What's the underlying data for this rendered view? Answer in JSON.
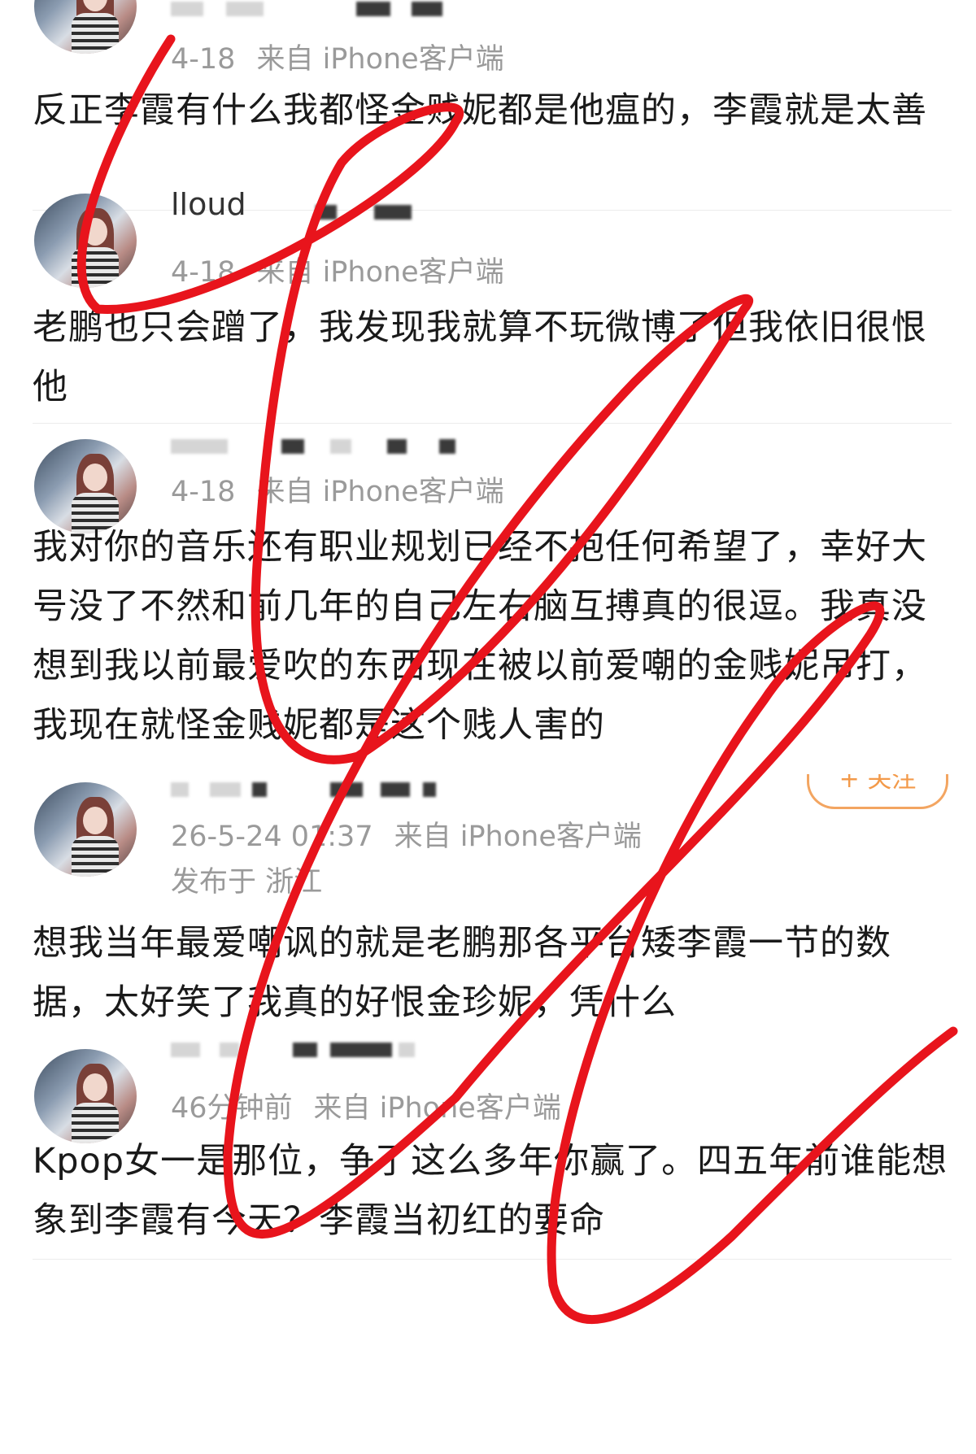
{
  "posts": [
    {
      "time": "4-18",
      "source": "来自 iPhone客户端",
      "content": "反正李霞有什么我都怪金贱妮都是他瘟的，李霞就是太善"
    },
    {
      "username": "lloud",
      "time": "4-18",
      "source": "来自 iPhone客户端",
      "content": "老鹏也只会蹭了，我发现我就算不玩微博了但我依旧很恨他"
    },
    {
      "time": "4-18",
      "source": "来自 iPhone客户端",
      "content": "我对你的音乐还有职业规划已经不抱任何希望了，幸好大号没了不然和前几年的自己左右脑互搏真的很逗。我真没想到我以前最爱吹的东西现在被以前爱嘲的金贱妮吊打，我现在就怪金贱妮都是这个贱人害的"
    },
    {
      "time": "26-5-24 01:37",
      "source": "来自 iPhone客户端",
      "location": "发布于 浙江",
      "follow_label": "+ 关注",
      "content": "想我当年最爱嘲讽的就是老鹏那各平台矮李霞一节的数据，太好笑了我真的好恨金珍妮，凭什么"
    },
    {
      "time": "46分钟前",
      "source": "来自 iPhone客户端",
      "content": "Kpop女一是那位，争了这么多年你赢了。四五年前谁能想象到李霞有今天？李霞当初红的要命"
    }
  ],
  "colors": {
    "scribble": "#e8141c",
    "meta_text": "#9a9a9a",
    "content_text": "#1a1a1a",
    "follow_accent": "#f39a4a"
  }
}
